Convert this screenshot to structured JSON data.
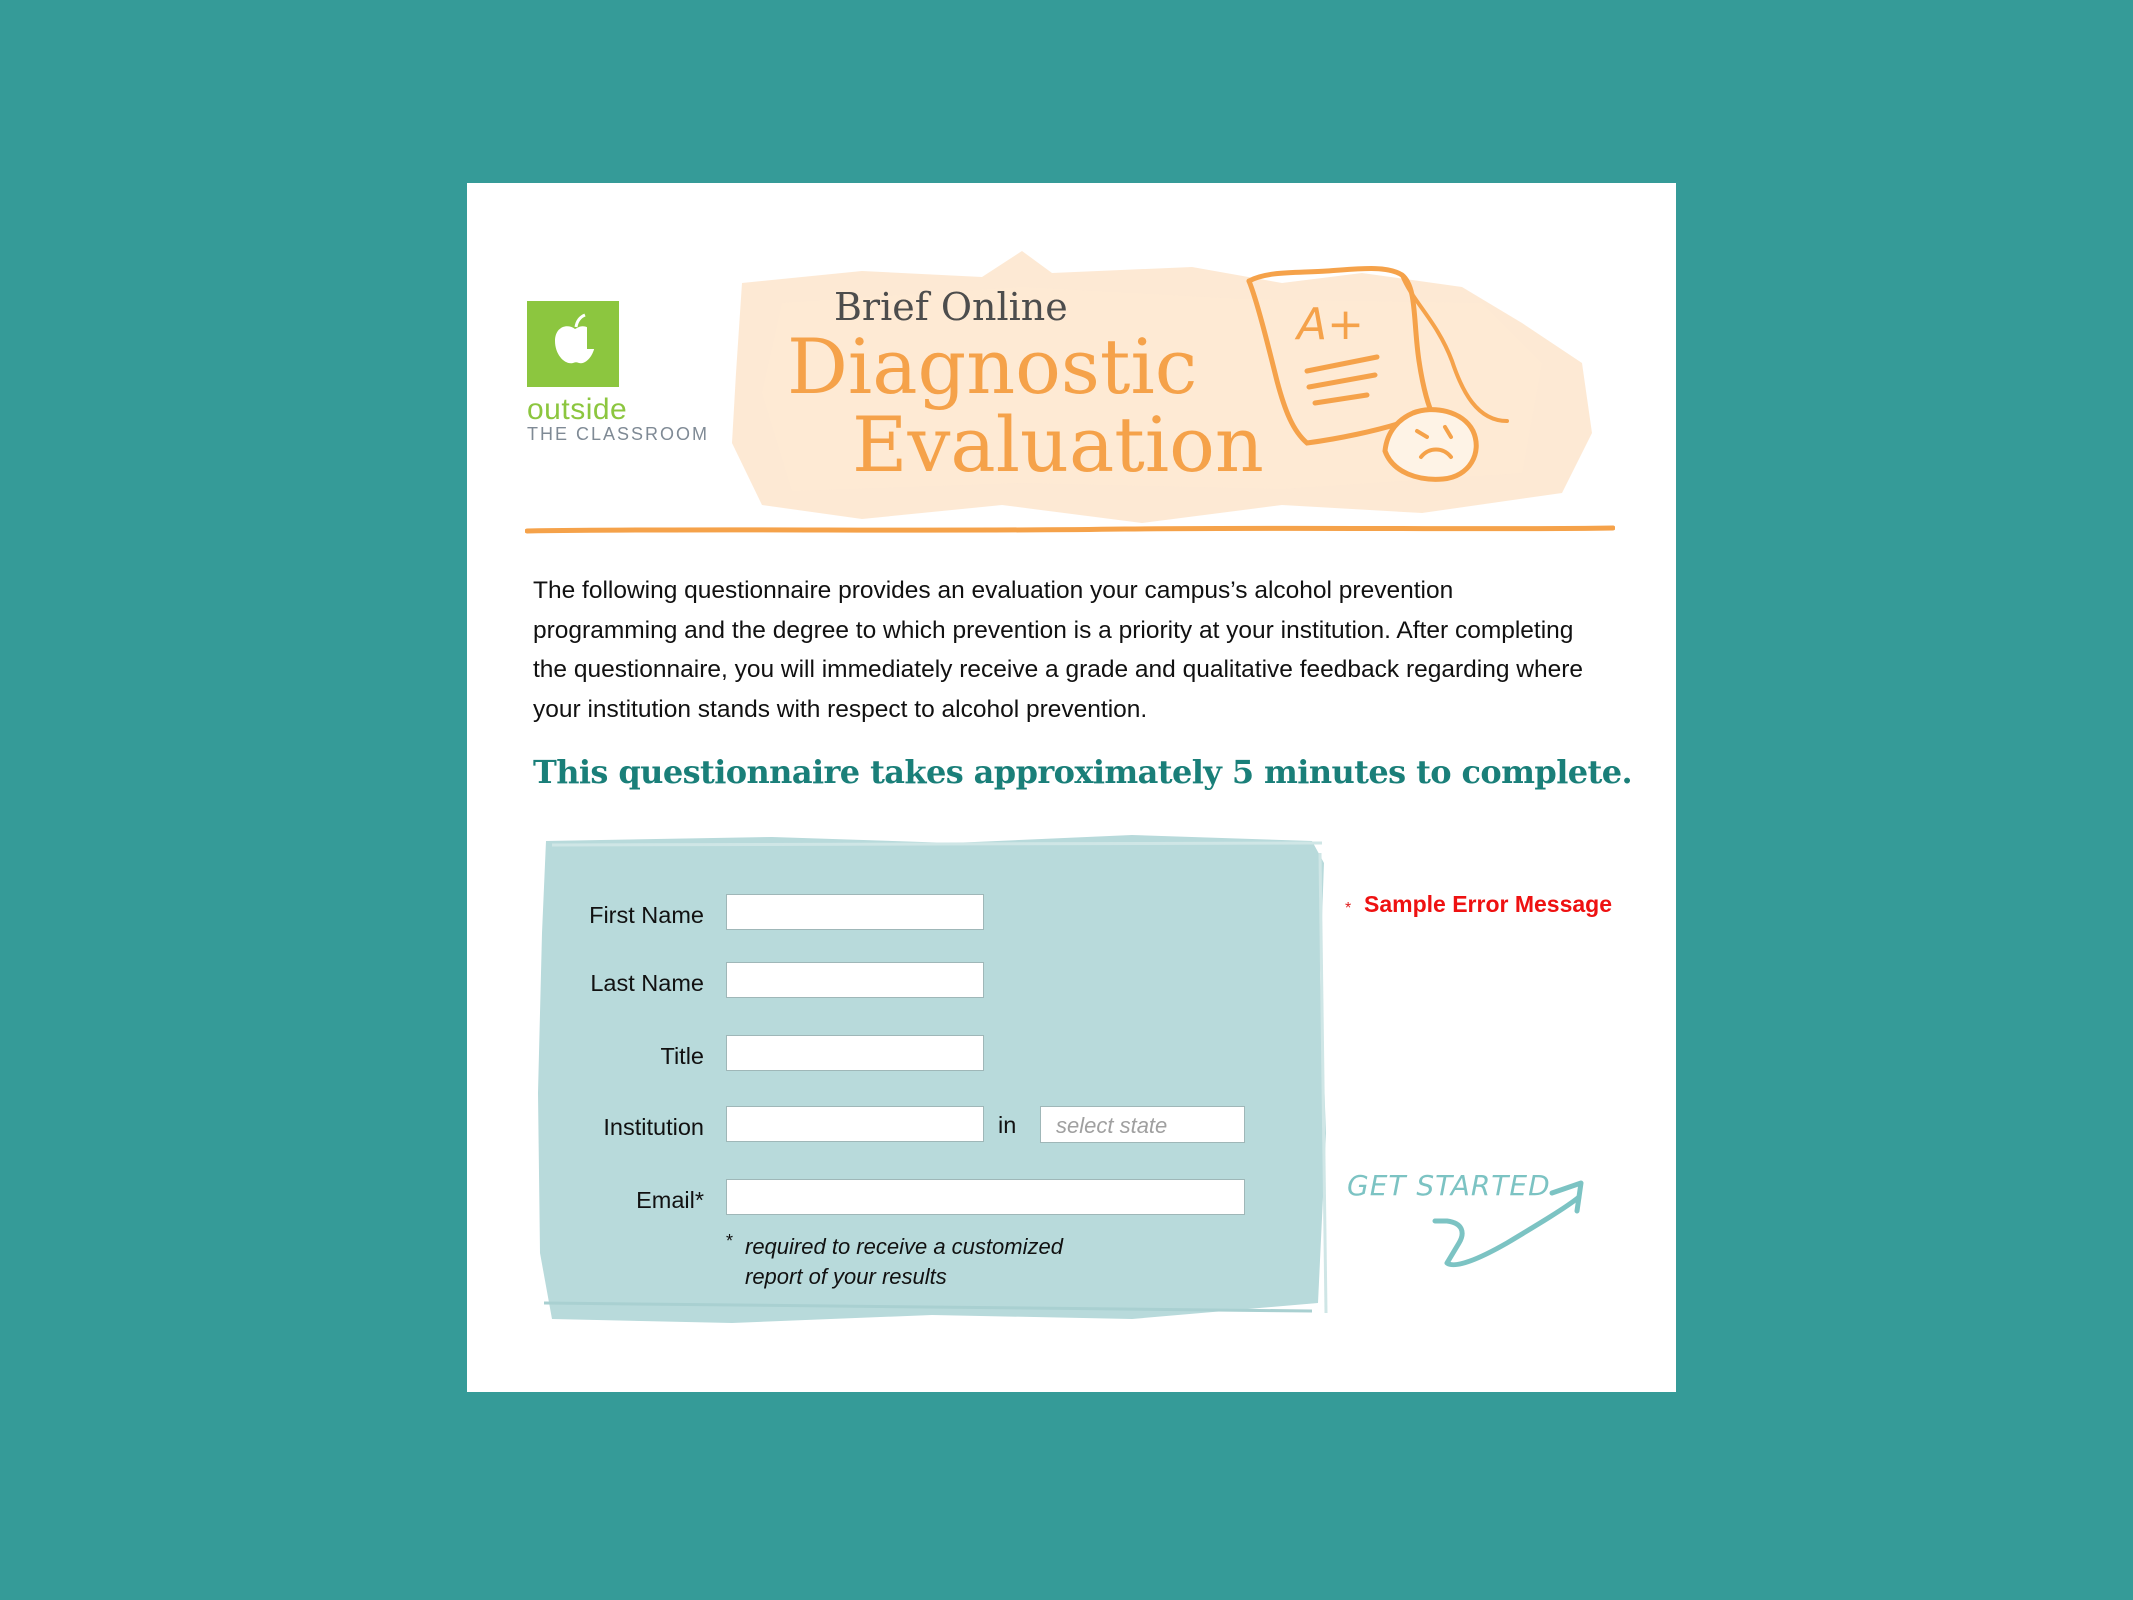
{
  "logo": {
    "name": "apple-logo-icon",
    "word": "outside",
    "sub": "THE CLASSROOM"
  },
  "header": {
    "title_small": "Brief Online",
    "title_line1": "Diagnostic",
    "title_line2": "Evaluation",
    "illustration": "graded-paper-a-plus-icon",
    "paper_grade": "A+"
  },
  "intro": {
    "text": "The following questionnaire provides an evaluation your campus’s alcohol prevention programming and the degree to which prevention is a priority at your institution. After completing the questionnaire, you will immediately receive a grade and qualitative feedback regarding where your institution stands with respect to alcohol prevention.",
    "callout": "This questionnaire takes approximately 5 minutes to complete."
  },
  "form": {
    "first_name_label": "First Name",
    "first_name_value": "",
    "last_name_label": "Last Name",
    "last_name_value": "",
    "title_label": "Title",
    "title_value": "",
    "institution_label": "Institution",
    "institution_value": "",
    "in_label": "in",
    "state_placeholder": "select state",
    "email_label": "Email*",
    "email_value": "",
    "note_star": "*",
    "note": "required to receive a customized report of your results"
  },
  "error": {
    "star": "*",
    "message": "Sample Error Message"
  },
  "cta": {
    "label": "GET STARTED",
    "icon": "arrow-up-right-icon"
  },
  "colors": {
    "background": "#359b98",
    "orange": "#f5a24a",
    "teal_text": "#1a7f79",
    "panel": "#b8dadb",
    "logo_green": "#8cc63f",
    "error": "#ee1111",
    "cta": "#7cc3c3"
  }
}
